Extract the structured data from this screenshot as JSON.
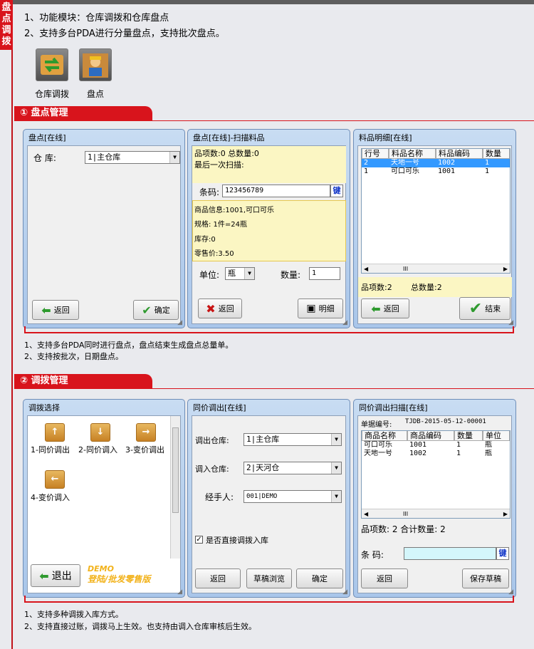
{
  "sidebar": {
    "tag": [
      "盘",
      "点",
      "调",
      "拨"
    ]
  },
  "features": [
    "1、功能模块：仓库调拨和仓库盘点",
    "2、支持多台PDA进行分量盘点，支持批次盘点。"
  ],
  "modules": [
    {
      "label": "仓库调拨",
      "icon": "transfer-arrows-icon"
    },
    {
      "label": "盘点",
      "icon": "warehouse-worker-icon"
    }
  ],
  "section1": {
    "title": "① 盘点管理",
    "win1": {
      "title": "盘点[在线]",
      "warehouse_label": "仓  库:",
      "warehouse_value": "1|主仓库",
      "back": "返回",
      "confirm": "确定"
    },
    "win2": {
      "title": "盘点[在线]-扫描料品",
      "summary": "品项数:0   总数量:0",
      "last_scan": "最后一次扫描:",
      "barcode_label": "条码:",
      "barcode_value": "123456789",
      "key": "键",
      "info": [
        "商品信息:1001,可口可乐",
        "规格:   1件=24瓶",
        "库存:0",
        "零售价:3.50"
      ],
      "unit_label": "单位:",
      "unit_value": "瓶",
      "qty_label": "数量:",
      "qty_value": "1",
      "delete": "返回",
      "detail": "明细"
    },
    "win3": {
      "title": "料品明细[在线]",
      "columns": [
        "行号",
        "料品名称",
        "料品编码",
        "数量"
      ],
      "rows": [
        [
          "2",
          "天地一号",
          "1002",
          "1"
        ],
        [
          "1",
          "可口可乐",
          "1001",
          "1"
        ]
      ],
      "scroll_mid": "III",
      "summary_count": "品项数:2",
      "summary_total": "总数量:2",
      "back": "返回",
      "finish": "结束"
    },
    "notes": [
      "1、支持多台PDA同时进行盘点，盘点结束生成盘点总量单。",
      "2、支持按批次，日期盘点。"
    ]
  },
  "section2": {
    "title": "② 调拨管理",
    "win1": {
      "title": "调拨选择",
      "tiles": [
        {
          "label": "1-同价调出",
          "glyph": "↑"
        },
        {
          "label": "2-同价调入",
          "glyph": "↓"
        },
        {
          "label": "3-变价调出",
          "glyph": "→"
        },
        {
          "label": "4-变价调入",
          "glyph": "←"
        }
      ],
      "exit": "退出",
      "demo1": "DEMO",
      "demo2": "登陆/批发零售版"
    },
    "win2": {
      "title": "同价调出[在线]",
      "out_label": "调出仓库:",
      "out_value": "1|主仓库",
      "in_label": "调入仓库:",
      "in_value": "2|天河仓",
      "handler_label": "经手人:",
      "handler_value": "001|DEMO",
      "direct_label": "是否直接调拨入库",
      "back": "返回",
      "drafts": "草稿浏览",
      "confirm": "确定"
    },
    "win3": {
      "title": "同价调出扫描[在线]",
      "doc_label": "单据编号:",
      "doc_value": "TJDB-2015-05-12-00001",
      "columns": [
        "商品名称",
        "商品编码",
        "数量",
        "单位"
      ],
      "rows": [
        [
          "可口可乐",
          "1001",
          "1",
          "瓶"
        ],
        [
          "天地一号",
          "1002",
          "1",
          "瓶"
        ]
      ],
      "scroll_mid": "III",
      "summary": "品项数: 2  合计数量: 2",
      "barcode_label": "条  码:",
      "key": "键",
      "back": "返回",
      "save": "保存草稿"
    },
    "notes": [
      "1、支持多种调拨入库方式。",
      "2、支持直接过账，调拨马上生效。也支持由调入仓库审核后生效。"
    ]
  },
  "colors": {
    "accent": "#d8141c",
    "window": "#b8d0ee",
    "yellow": "#fbf6c3",
    "selection": "#3399ff"
  }
}
